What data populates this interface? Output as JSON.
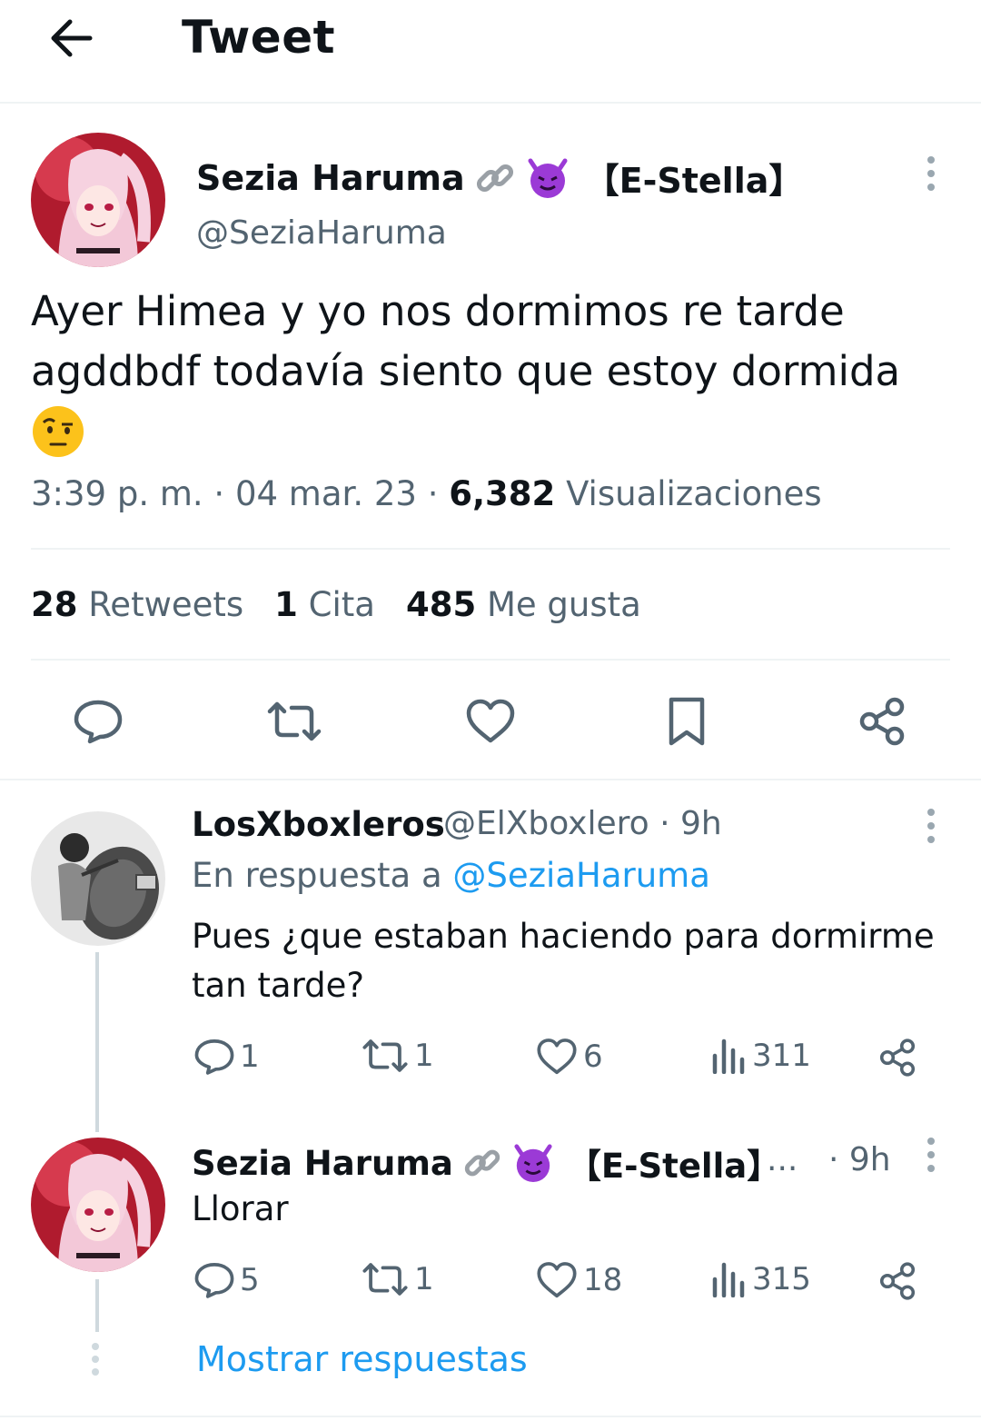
{
  "header": {
    "title": "Tweet",
    "back_icon": "arrow-left-icon"
  },
  "tweet": {
    "author_name": "Sezia Haruma",
    "name_emojis": [
      "link-icon",
      "smiling-devil-icon"
    ],
    "author_tag": "【E-Stella】",
    "handle": "@SeziaHaruma",
    "text_line1": "Ayer Himea y yo nos dormimos re tarde",
    "text_line2": "agddbdf todavía siento que estoy dormida",
    "text_emoji": "face-with-raised-eyebrow-icon",
    "time": "3:39 p. m.",
    "date": "04 mar. 23",
    "views_count": "6,382",
    "views_label": "Visualizaciones",
    "retweets_count": "28",
    "retweets_label": "Retweets",
    "quotes_count": "1",
    "quotes_label": "Cita",
    "likes_count": "485",
    "likes_label": "Me gusta",
    "actions": [
      "reply-icon",
      "retweet-icon",
      "like-icon",
      "bookmark-icon",
      "share-icon"
    ]
  },
  "replies": [
    {
      "name": "LosXboxleros",
      "handle": "@ElXboxlero",
      "time": "9h",
      "in_reply_prefix": "En respuesta a",
      "in_reply_handle": "@SeziaHaruma",
      "text_line1": "Pues ¿que estaban haciendo para dormirme",
      "text_line2": "tan tarde?",
      "replies": "1",
      "retweets": "1",
      "likes": "6",
      "views": "311"
    },
    {
      "name": "Sezia Haruma",
      "tag": "【E-Stella】",
      "ellipsis": "...",
      "time": "9h",
      "text": "Llorar",
      "replies": "5",
      "retweets": "1",
      "likes": "18",
      "views": "315"
    }
  ],
  "show_replies": "Mostrar respuestas",
  "colors": {
    "accent": "#1d9bf0",
    "secondary_text": "#536471",
    "divider": "#eff3f4"
  }
}
